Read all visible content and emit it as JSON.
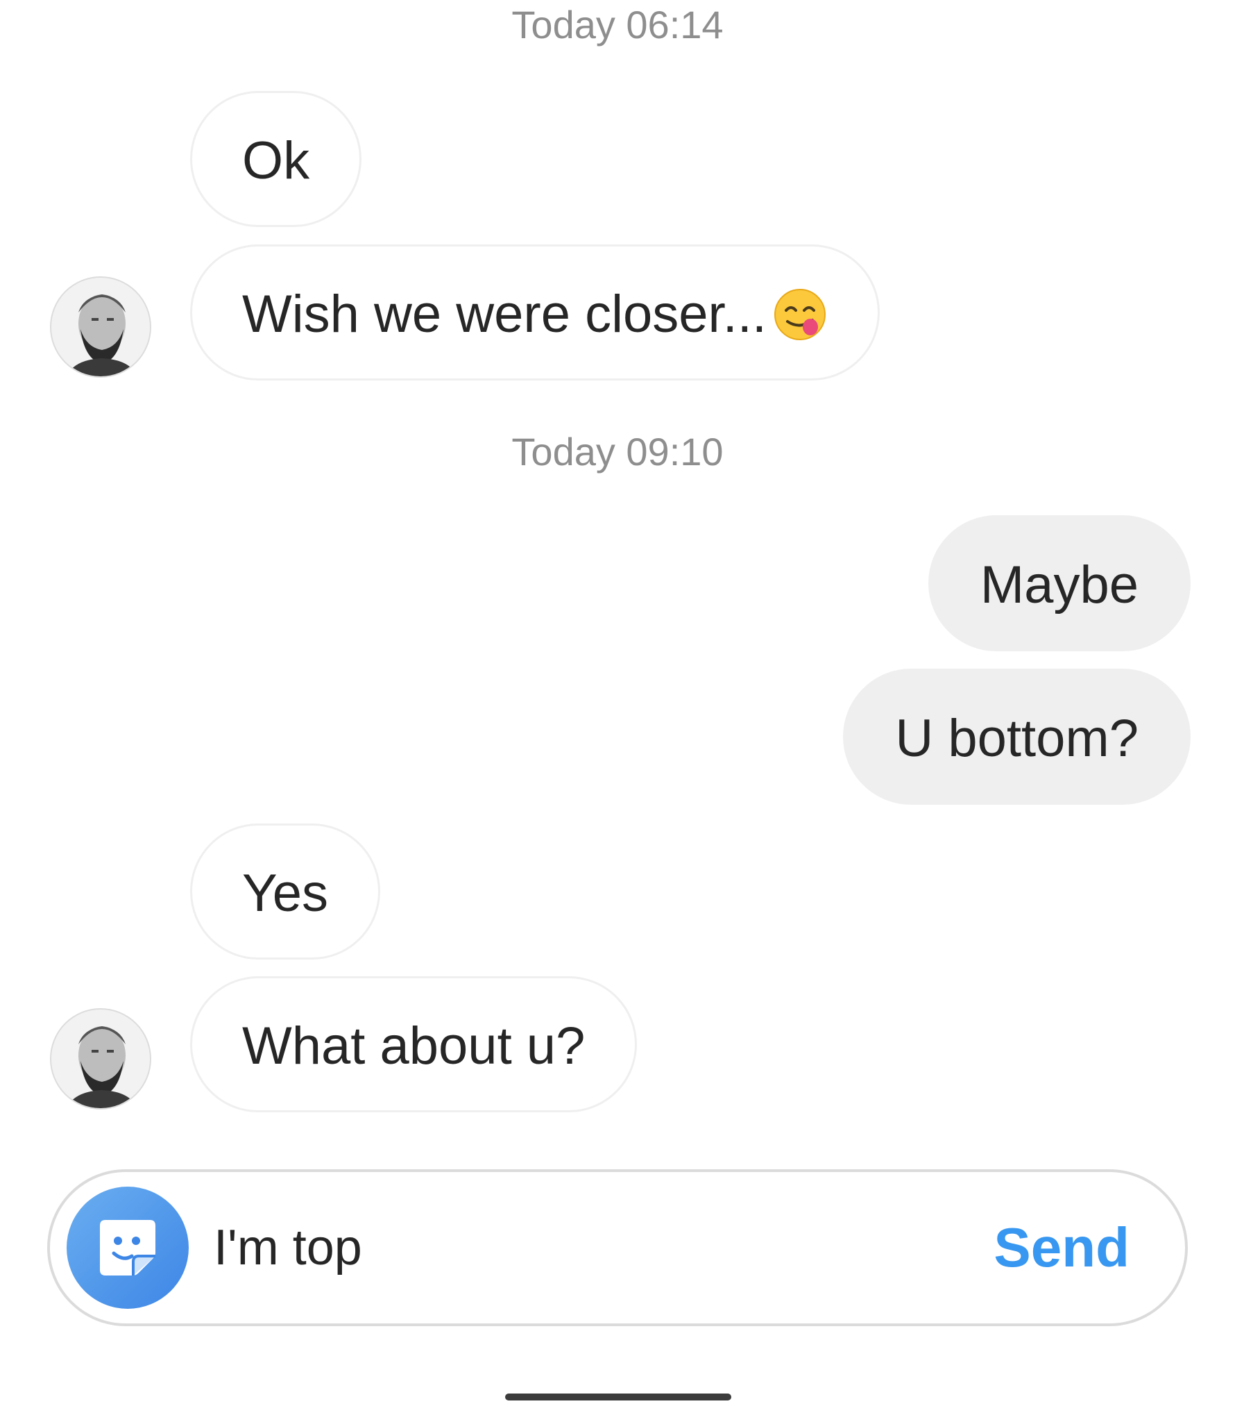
{
  "conversation": {
    "groups": [
      {
        "timestamp": "Today 06:14",
        "messages": [
          {
            "direction": "received",
            "text": "Ok"
          },
          {
            "direction": "received",
            "text": "Wish we were closer...",
            "emoji": "face-savoring-food-emoji"
          }
        ]
      },
      {
        "timestamp": "Today 09:10",
        "messages": [
          {
            "direction": "sent",
            "text": "Maybe"
          },
          {
            "direction": "sent",
            "text": "U bottom?"
          },
          {
            "direction": "received",
            "text": "Yes"
          },
          {
            "direction": "received",
            "text": "What about u?"
          }
        ]
      }
    ]
  },
  "composer": {
    "value": "I'm top",
    "send_label": "Send",
    "sticker_icon": "sticker-icon"
  },
  "colors": {
    "sent_bubble": "#efefef",
    "received_border": "#efefef",
    "send_accent": "#3897f0",
    "timestamp": "#8e8e8e",
    "sticker_gradient_start": "#6aaef0",
    "sticker_gradient_end": "#3d86e6"
  }
}
